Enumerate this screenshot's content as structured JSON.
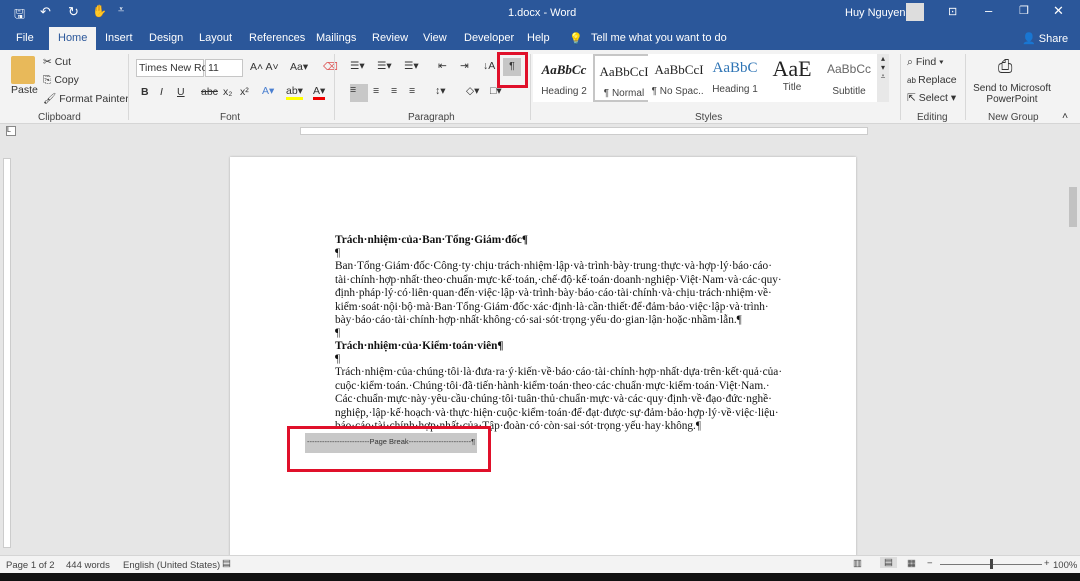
{
  "window": {
    "title": "1.docx - Word",
    "user": "Huy Nguyen"
  },
  "tabs": [
    "File",
    "Home",
    "Insert",
    "Design",
    "Layout",
    "References",
    "Mailings",
    "Review",
    "View",
    "Developer",
    "Help"
  ],
  "tell_me": "Tell me what you want to do",
  "share": "Share",
  "clipboard": {
    "paste": "Paste",
    "cut": "Cut",
    "copy": "Copy",
    "format_painter": "Format Painter",
    "label": "Clipboard"
  },
  "font": {
    "name": "Times New Ro",
    "size": "11",
    "label": "Font"
  },
  "paragraph": {
    "label": "Paragraph",
    "show_marks": "¶"
  },
  "styles": {
    "label": "Styles",
    "items": [
      {
        "preview": "AaBbCc",
        "name": "Heading 2"
      },
      {
        "preview": "AaBbCcI",
        "name": "¶ Normal"
      },
      {
        "preview": "AaBbCcI",
        "name": "¶ No Spac..."
      },
      {
        "preview": "AaBbC",
        "name": "Heading 1"
      },
      {
        "preview": "AaE",
        "name": "Title"
      },
      {
        "preview": "AaBbCc",
        "name": "Subtitle"
      }
    ]
  },
  "editing": {
    "find": "Find",
    "replace": "Replace",
    "select": "Select",
    "label": "Editing"
  },
  "newgroup": {
    "send": "Send to Microsoft PowerPoint",
    "label": "New Group"
  },
  "document": {
    "h1": "Trách·nhiệm·của·Ban·Tổng·Giám·đốc¶",
    "p1": "Ban·Tổng·Giám·đốc·Công·ty·chịu·trách·nhiệm·lập·và·trình·bày·trung·thực·và·hợp·lý·báo·cáo·tài·chính·hợp·nhất·theo·chuẩn·mực·kế·toán,·chế·độ·kế·toán·doanh·nghiệp·Việt·Nam·và·các·quy·định·pháp·lý·có·liên·quan·đến·việc·lập·và·trình·bày·báo·cáo·tài·chính·và·chịu·trách·nhiệm·về·kiểm·soát·nội·bộ·mà·Ban·Tổng·Giám·đốc·xác·định·là·cần·thiết·để·đảm·bảo·việc·lập·và·trình·bày·báo·cáo·tài·chính·hợp·nhất·không·có·sai·sót·trọng·yếu·do·gian·lận·hoặc·nhầm·lẫn.¶",
    "h2": "Trách·nhiệm·của·Kiểm·toán·viên¶",
    "p2": "Trách·nhiệm·của·chúng·tôi·là·đưa·ra·ý·kiến·về·báo·cáo·tài·chính·hợp·nhất·dựa·trên·kết·quả·của·cuộc·kiểm·toán.·Chúng·tôi·đã·tiến·hành·kiểm·toán·theo·các·chuẩn·mực·kiểm·toán·Việt·Nam.·Các·chuẩn·mực·này·yêu·cầu·chúng·tôi·tuân·thủ·chuẩn·mực·và·các·quy·định·về·đạo·đức·nghề·nghiệp,·lập·kế·hoạch·và·thực·hiện·cuộc·kiểm·toán·để·đạt·được·sự·đảm·bảo·hợp·lý·về·việc·liệu·báo·cáo·tài·chính·hợp·nhất·của·Tập·đoàn·có·còn·sai·sót·trọng·yếu·hay·không.¶",
    "pilcrow": "¶",
    "page_break": "-------------------------Page Break-------------------------¶"
  },
  "status": {
    "page": "Page 1 of 2",
    "words": "444 words",
    "language": "English (United States)",
    "zoom": "100%"
  },
  "highlight_color": "#e0102a"
}
